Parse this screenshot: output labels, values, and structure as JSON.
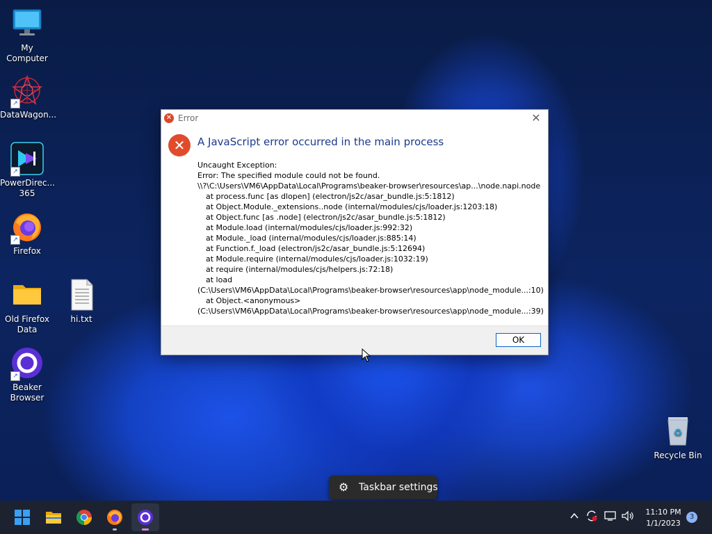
{
  "desktop": {
    "icons": [
      {
        "label": "My Computer"
      },
      {
        "label": "DataWagon..."
      },
      {
        "label": "PowerDirec...\n365"
      },
      {
        "label": "Firefox"
      },
      {
        "label": "Old Firefox\nData"
      },
      {
        "label": "hi.txt"
      },
      {
        "label": "Beaker\nBrowser"
      },
      {
        "label": "Recycle Bin"
      }
    ]
  },
  "dialog": {
    "title": "Error",
    "heading": "A JavaScript error occurred in the main process",
    "message_lines": [
      "Uncaught Exception:",
      "Error: The specified module could not be found.",
      "\\\\?\\C:\\Users\\VM6\\AppData\\Local\\Programs\\beaker-browser\\resources\\ap...\\node.napi.node",
      "at process.func [as dlopen] (electron/js2c/asar_bundle.js:5:1812)",
      "at Object.Module._extensions..node (internal/modules/cjs/loader.js:1203:18)",
      "at Object.func [as .node] (electron/js2c/asar_bundle.js:5:1812)",
      "at Module.load (internal/modules/cjs/loader.js:992:32)",
      "at Module._load (internal/modules/cjs/loader.js:885:14)",
      "at Function.f._load (electron/js2c/asar_bundle.js:5:12694)",
      "at Module.require (internal/modules/cjs/loader.js:1032:19)",
      "at require (internal/modules/cjs/helpers.js:72:18)",
      "at load",
      "(C:\\Users\\VM6\\AppData\\Local\\Programs\\beaker-browser\\resources\\app\\node_module...:10)",
      "at Object.<anonymous>",
      "(C:\\Users\\VM6\\AppData\\Local\\Programs\\beaker-browser\\resources\\app\\node_module...:39)"
    ],
    "ok_label": "OK"
  },
  "tooltip": {
    "text": "Taskbar settings"
  },
  "taskbar": {
    "apps": [
      "start-icon",
      "file-explorer-icon",
      "chrome-icon",
      "firefox-icon",
      "beaker-browser-icon"
    ],
    "clock": {
      "time": "11:10 PM",
      "date": "1/1/2023"
    },
    "notification_count": "3"
  },
  "colors": {
    "taskbar_bg": "#1c2230",
    "dialog_heading": "#1a3a8c",
    "error_red": "#e04b2c",
    "ok_border": "#0a64c8"
  }
}
